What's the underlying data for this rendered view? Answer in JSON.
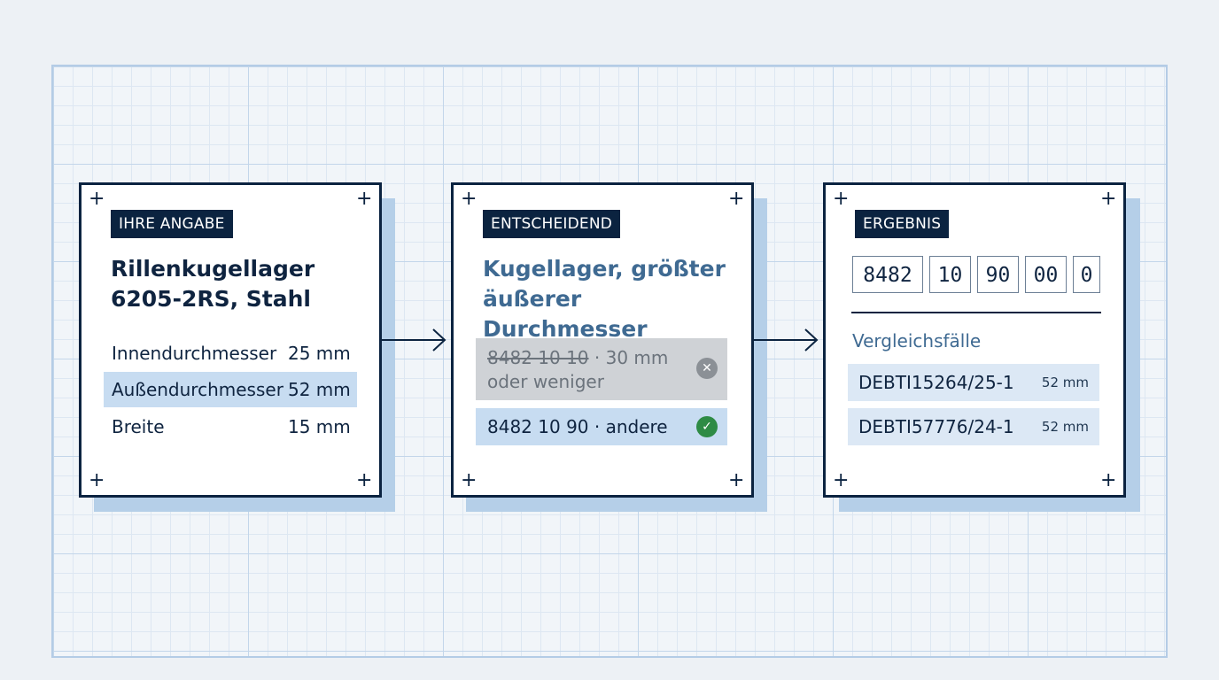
{
  "card1": {
    "tag": "IHRE ANGABE",
    "title_line1": "Rillenkugellager",
    "title_line2": "6205-2RS, Stahl",
    "rows": [
      {
        "label": "Innendurchmesser",
        "value": "25 mm"
      },
      {
        "label": "Außendurchmesser",
        "value": "52 mm"
      },
      {
        "label": "Breite",
        "value": "15 mm"
      }
    ]
  },
  "card2": {
    "tag": "ENTSCHEIDEND",
    "title_line1": "Kugellager, größter",
    "title_line2": "äußerer Durchmesser",
    "rejected": {
      "code": "8482 10 10",
      "text_line1": " · 30 mm",
      "text_line2": "oder weniger"
    },
    "selected": {
      "text": "8482 10 90 · andere"
    }
  },
  "card3": {
    "tag": "ERGEBNIS",
    "code_parts": [
      "8482",
      "10",
      "90",
      "00",
      "0"
    ],
    "subheading": "Vergleichsfälle",
    "references": [
      {
        "id": "DEBTI15264/25-1",
        "size": "52 mm"
      },
      {
        "id": "DEBTI57776/24-1",
        "size": "52 mm"
      }
    ]
  },
  "icons": {
    "reject": "x-circle-icon",
    "accept": "check-circle-icon",
    "corner": "plus-icon"
  },
  "colors": {
    "navy": "#0b2340",
    "highlight": "#c7dcf1",
    "accent_blue": "#3f6a92",
    "check_green": "#2e8b45",
    "reject_gray": "#8b9096"
  }
}
